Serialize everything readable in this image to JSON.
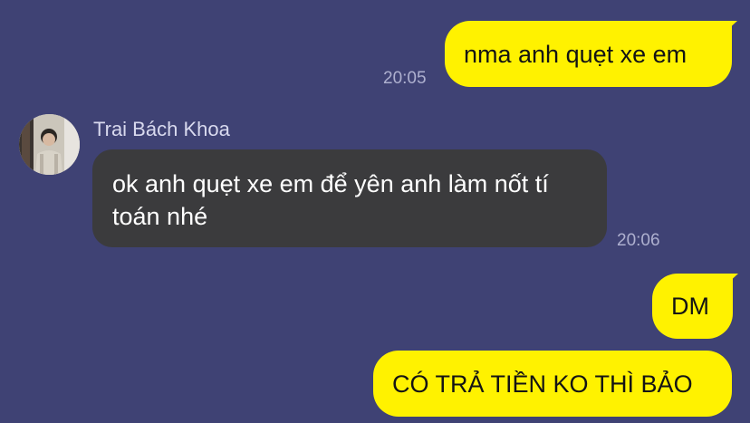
{
  "conversation": {
    "contact": {
      "name": "Trai Bách Khoa",
      "avatar_icon": "person-photo-avatar"
    },
    "messages": [
      {
        "direction": "outgoing",
        "text": "nma anh quẹt xe em",
        "time": "20:05"
      },
      {
        "direction": "incoming",
        "text": "ok anh quẹt xe em để yên anh làm nốt tí toán nhé",
        "time": "20:06"
      },
      {
        "direction": "outgoing",
        "text": "DM",
        "time": ""
      },
      {
        "direction": "outgoing",
        "text": "CÓ TRẢ TIỀN KO THÌ BẢO",
        "time": ""
      }
    ]
  },
  "colors": {
    "background": "#3f4274",
    "outgoing_bubble": "#fff200",
    "incoming_bubble": "#3b3b3d",
    "timestamp": "#aeb0cf",
    "sender_name": "#d8d9ee"
  }
}
